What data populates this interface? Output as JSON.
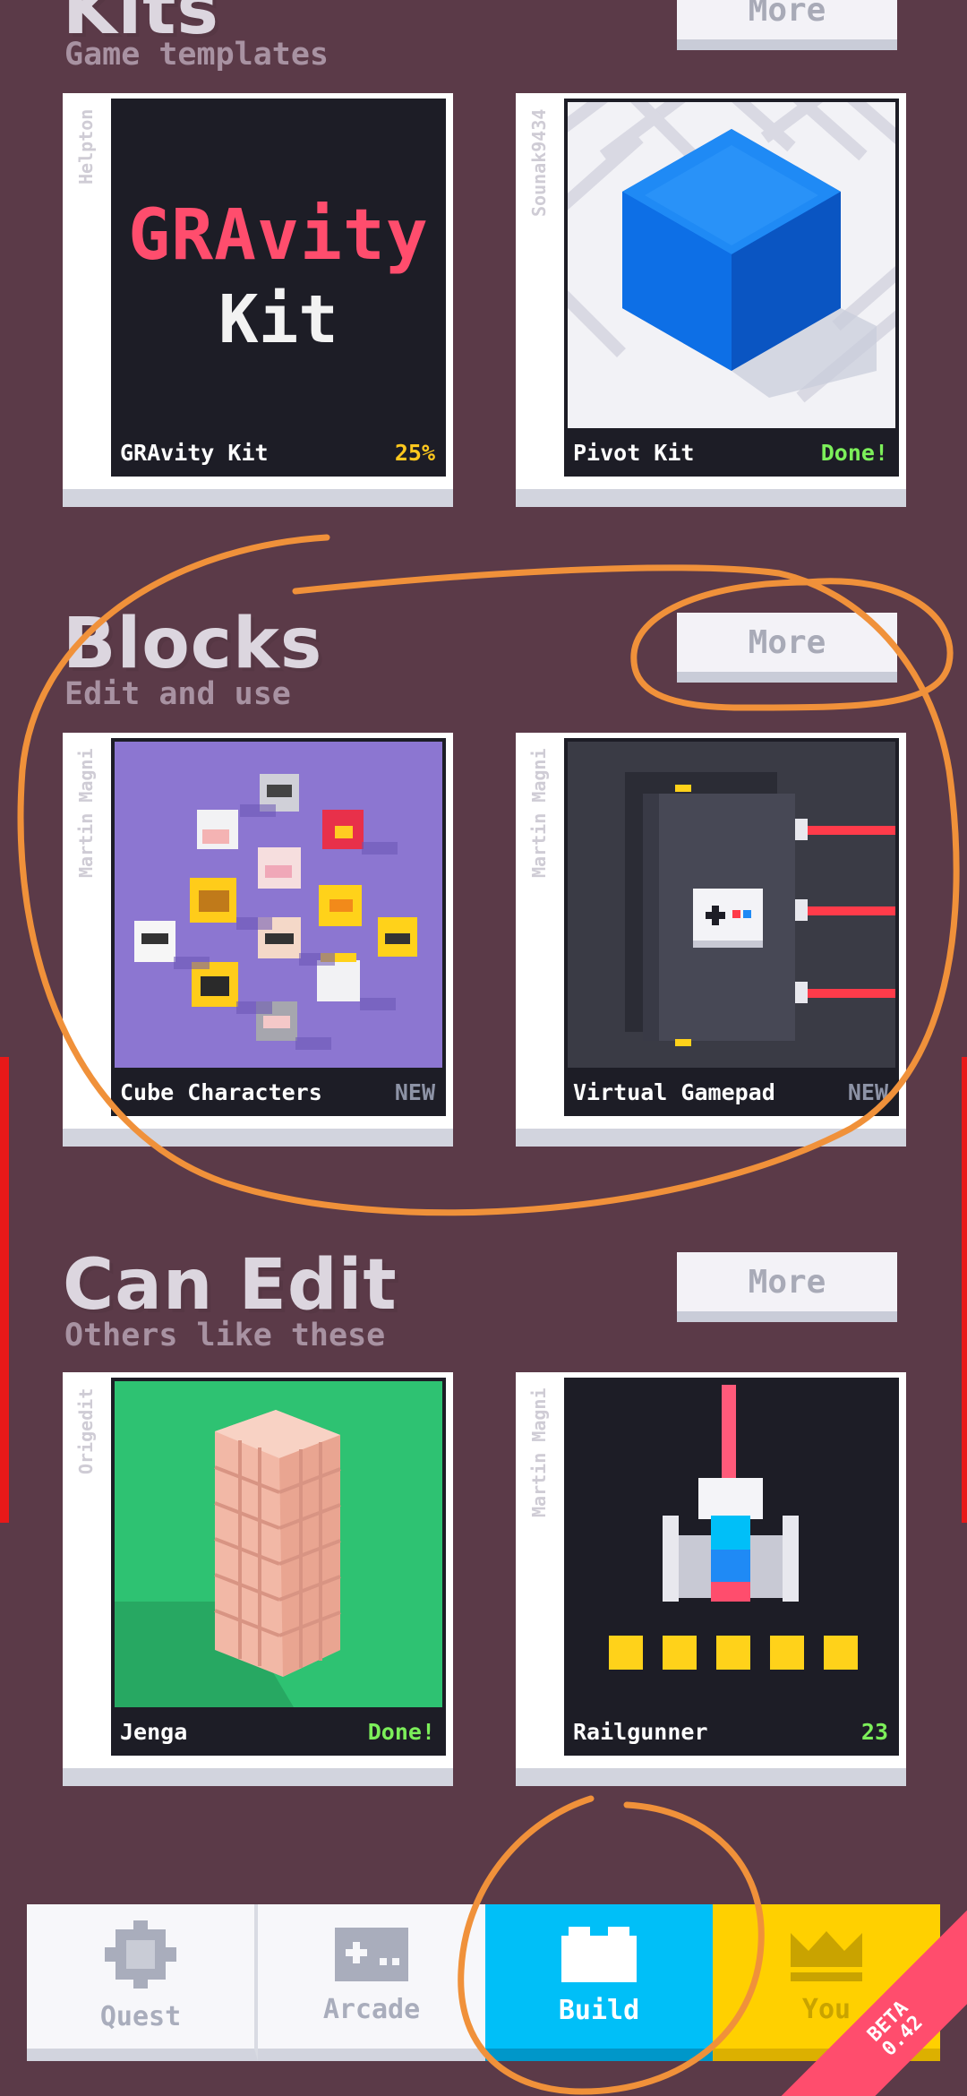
{
  "sections": [
    {
      "title": "Kits",
      "subtitle": "Game templates",
      "more_label": "More",
      "cards": [
        {
          "name": "GRAvity Kit",
          "author": "Helpton",
          "status": "25%",
          "status_color": "#ffc81e",
          "art_text_top": "GRAvity",
          "art_text_bottom": "Kit"
        },
        {
          "name": "Pivot Kit",
          "author": "Sounak9434",
          "status": "Done!",
          "status_color": "#7cef5a"
        }
      ]
    },
    {
      "title": "Blocks",
      "subtitle": "Edit and use",
      "more_label": "More",
      "cards": [
        {
          "name": "Cube Characters",
          "author": "Martin Magni",
          "status": "NEW",
          "status_color": "#8d93a6"
        },
        {
          "name": "Virtual Gamepad",
          "author": "Martin Magni",
          "status": "NEW",
          "status_color": "#8d93a6"
        }
      ]
    },
    {
      "title": "Can Edit",
      "subtitle": "Others like these",
      "more_label": "More",
      "cards": [
        {
          "name": "Jenga",
          "author": "Origedit",
          "status": "Done!",
          "status_color": "#7cef5a"
        },
        {
          "name": "Railgunner",
          "author": "Martin Magni",
          "status": "23",
          "status_color": "#7cef5a"
        }
      ]
    }
  ],
  "nav": {
    "tabs": [
      {
        "label": "Quest",
        "icon": "gear-icon",
        "active": false
      },
      {
        "label": "Arcade",
        "icon": "gamepad-icon",
        "active": false
      },
      {
        "label": "Build",
        "icon": "brick-icon",
        "active": true
      },
      {
        "label": "You",
        "icon": "crown-icon",
        "active": false
      }
    ]
  },
  "beta_badge": {
    "line1": "BETA",
    "line2": "0.42"
  },
  "colors": {
    "background": "#5b3a48",
    "build_tab": "#00bff8",
    "you_tab": "#ffd000",
    "annotation": "#f0913a"
  }
}
